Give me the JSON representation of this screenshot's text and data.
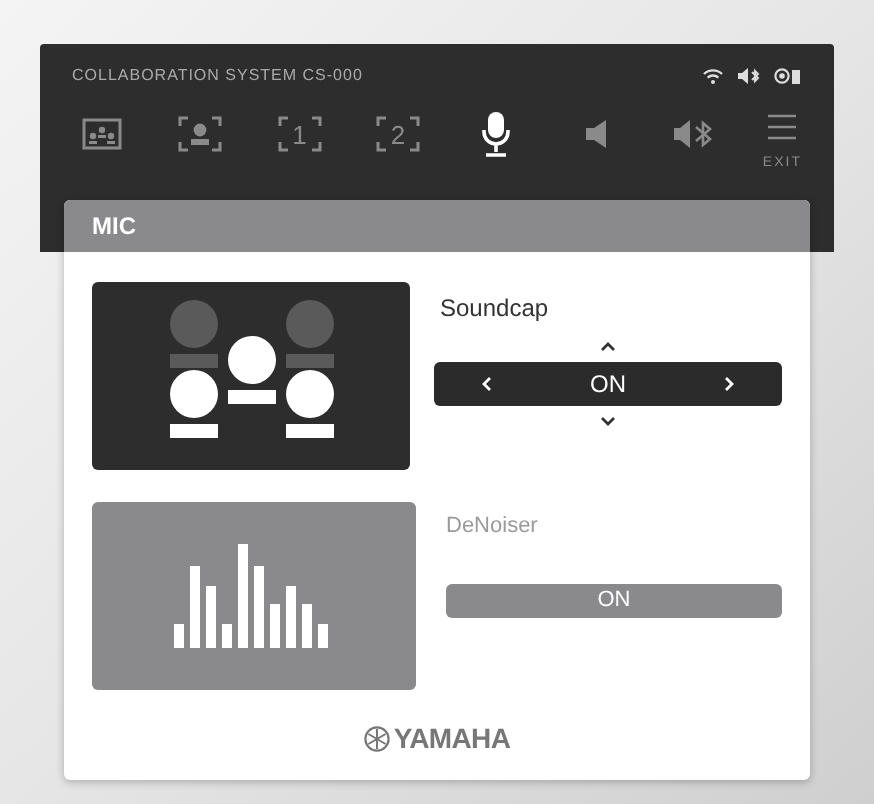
{
  "header": {
    "title": "COLLABORATION SYSTEM CS-000"
  },
  "tabs": [
    {
      "kind": "layout",
      "selected": false
    },
    {
      "kind": "camera",
      "selected": false
    },
    {
      "kind": "preset",
      "label": "1",
      "selected": false
    },
    {
      "kind": "preset",
      "label": "2",
      "selected": false
    },
    {
      "kind": "mic",
      "selected": true
    },
    {
      "kind": "speaker",
      "selected": false
    },
    {
      "kind": "bluetooth",
      "selected": false
    }
  ],
  "menu": {
    "label": "EXIT"
  },
  "panel": {
    "title": "MIC"
  },
  "settings": [
    {
      "kind": "selector",
      "label": "Soundcap",
      "value": "ON",
      "disabled": false
    },
    {
      "kind": "toggle",
      "label": "DeNoiser",
      "value": "ON",
      "disabled": true
    }
  ],
  "footer": {
    "brand": "YAMAHA"
  }
}
